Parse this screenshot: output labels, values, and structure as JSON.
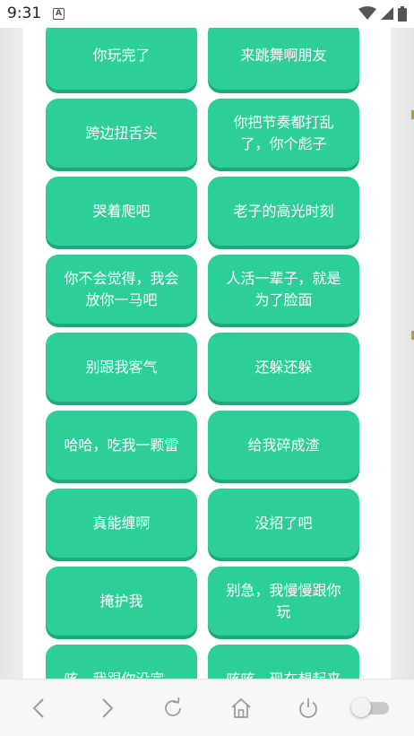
{
  "status_bar": {
    "time": "9:31",
    "notification_icon": "a-box-icon"
  },
  "buttons": [
    {
      "label": "你玩完了"
    },
    {
      "label": "来跳舞啊朋友"
    },
    {
      "label": "跨边扭舌头"
    },
    {
      "label": "你把节奏都打乱了，你个彪子"
    },
    {
      "label": "哭着爬吧"
    },
    {
      "label": "老子的高光时刻"
    },
    {
      "label": "你不会觉得，我会放你一马吧"
    },
    {
      "label": "人活一辈子，就是为了脸面"
    },
    {
      "label": "别跟我客气"
    },
    {
      "label": "还躲还躲"
    },
    {
      "label": "哈哈，吃我一颗雷"
    },
    {
      "label": "给我碎成渣"
    },
    {
      "label": "真能缠啊"
    },
    {
      "label": "没招了吧"
    },
    {
      "label": "掩护我"
    },
    {
      "label": "别急，我慢慢跟你玩"
    },
    {
      "label": "咳，我跟你没完，"
    },
    {
      "label": "咳咳，现在想起来"
    }
  ],
  "colors": {
    "button": "#2ccf98",
    "button_shadow": "#1fa87b",
    "button_text": "#ffffff",
    "page_background": "#e9ebe9"
  },
  "nav_bar": {
    "icons": [
      "back-icon",
      "forward-icon",
      "refresh-icon",
      "home-icon",
      "power-icon",
      "toggle-switch"
    ]
  }
}
